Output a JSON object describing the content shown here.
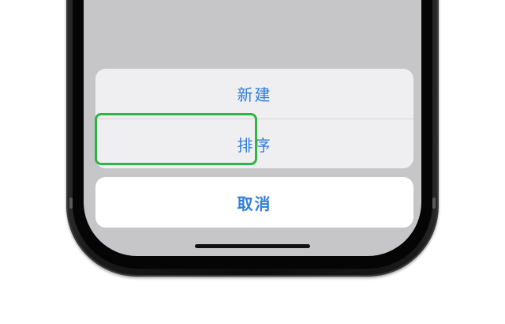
{
  "action_sheet": {
    "items": [
      {
        "label": "新建",
        "highlighted": true
      },
      {
        "label": "排序",
        "highlighted": false
      }
    ],
    "cancel_label": "取消"
  },
  "colors": {
    "action_text": "#2f7ed8",
    "highlight_border": "#2db546",
    "screen_dim": "#c6c6c9",
    "sheet_background": "#efeff1",
    "cancel_background": "#ffffff"
  }
}
